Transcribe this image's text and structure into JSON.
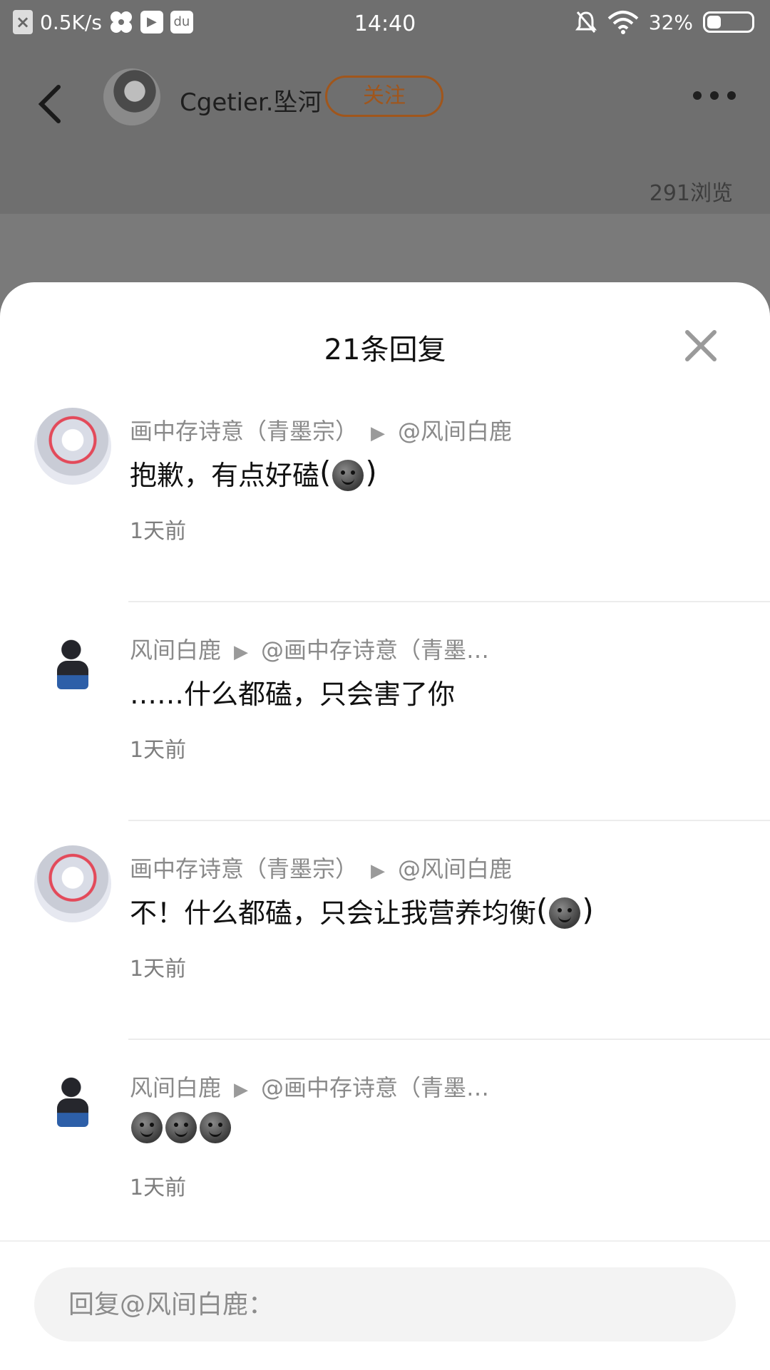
{
  "status_bar": {
    "net_speed": "0.5K/s",
    "time": "14:40",
    "battery": "32%",
    "battery_level": 0.32,
    "icons": [
      "close-icon",
      "pinwheel-icon",
      "play-icon",
      "baidu-icon",
      "mute-bell-icon",
      "wifi-icon",
      "battery-icon"
    ]
  },
  "header": {
    "author_name": "Cgetier.坠河",
    "follow_label": "关注",
    "views": "291浏览"
  },
  "sheet": {
    "title": "21条回复",
    "replies": [
      {
        "user": "画中存诗意（青墨宗）",
        "target": "@风间白鹿",
        "text": "抱歉，有点好磕",
        "emoji_count": 1,
        "bracketed": true,
        "time": "1天前",
        "avatar": "a"
      },
      {
        "user": "风间白鹿",
        "target": "@画中存诗意（青墨…",
        "text": "……什么都磕，只会害了你",
        "emoji_count": 0,
        "bracketed": false,
        "time": "1天前",
        "avatar": "b"
      },
      {
        "user": "画中存诗意（青墨宗）",
        "target": "@风间白鹿",
        "text": "不！什么都磕，只会让我营养均衡",
        "emoji_count": 1,
        "bracketed": true,
        "time": "1天前",
        "avatar": "a"
      },
      {
        "user": "风间白鹿",
        "target": "@画中存诗意（青墨…",
        "text": "",
        "emoji_count": 3,
        "bracketed": false,
        "time": "1天前",
        "avatar": "b"
      }
    ]
  },
  "reply_input": {
    "placeholder": "回复@风间白鹿："
  }
}
